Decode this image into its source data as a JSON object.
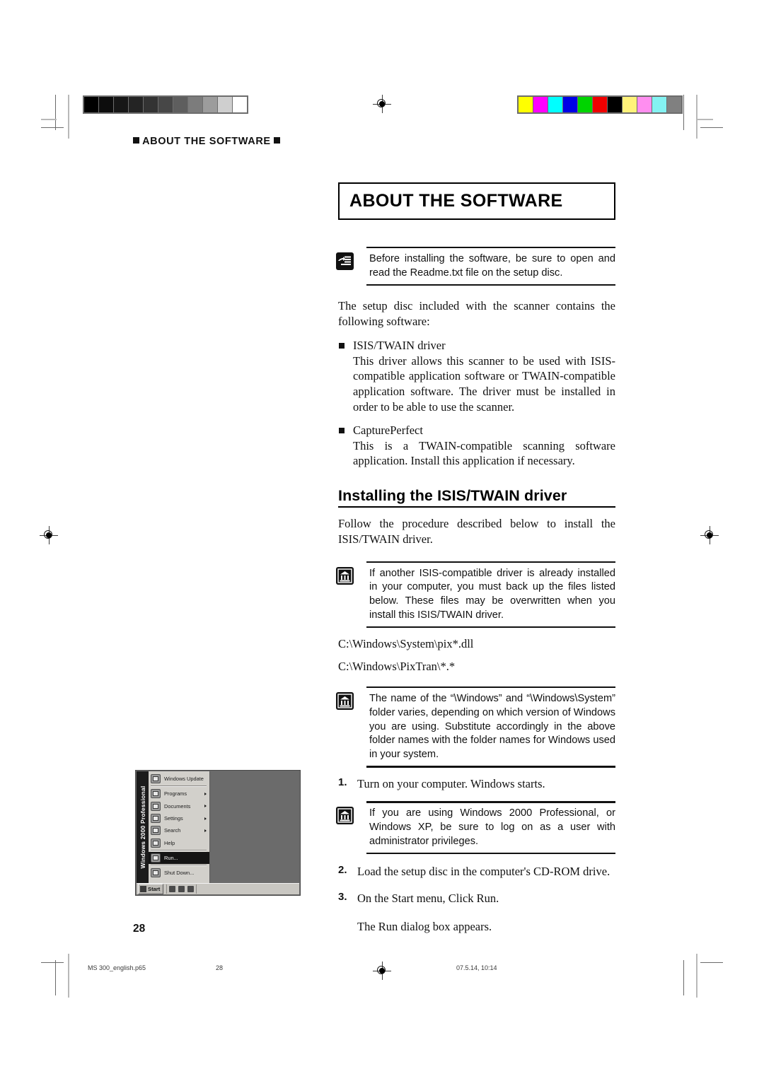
{
  "document": {
    "running_head": "ABOUT THE SOFTWARE",
    "page_number": "28"
  },
  "chapter": {
    "title": "ABOUT THE SOFTWARE"
  },
  "notes": [
    {
      "icon": "note-hand-icon",
      "text": "Before installing the software, be sure to open and read the Readme.txt file on the setup disc."
    },
    {
      "icon": "important-memo-icon",
      "text": "If another ISIS-compatible driver is already installed in your computer, you must back up the files listed below. These files may be overwritten when you install this ISIS/TWAIN driver."
    },
    {
      "icon": "important-memo-icon",
      "text": "The name of the “\\Windows” and “\\Windows\\System” folder varies, depending on which version of Windows you are using. Substitute accordingly in the above folder names with the folder names for Windows used in your system."
    },
    {
      "icon": "important-memo-icon",
      "text": "If you are using Windows 2000 Professional, or Windows XP, be sure to log on as a user with administrator privileges."
    }
  ],
  "intro": {
    "paragraph": "The setup disc included with the scanner contains the following software:"
  },
  "software_list": [
    {
      "name": "ISIS/TWAIN driver",
      "description": "This driver allows this scanner to be used with ISIS-compatible application software or TWAIN-compatible application software. The driver must be installed in order to be able to use the scanner."
    },
    {
      "name": "CapturePerfect",
      "description": "This is a TWAIN-compatible scanning software application. Install this application if necessary."
    }
  ],
  "section": {
    "heading": "Installing the ISIS/TWAIN driver",
    "lead": "Follow the procedure described below to install the ISIS/TWAIN driver.",
    "paths": [
      "C:\\Windows\\System\\pix*.dll",
      "C:\\Windows\\PixTran\\*.*"
    ],
    "steps": [
      {
        "number": "1.",
        "text": "Turn on your computer. Windows starts."
      },
      {
        "number": "2.",
        "text": "Load the setup disc in the computer's CD-ROM drive."
      },
      {
        "number": "3.",
        "text": "On the Start menu, Click Run."
      }
    ],
    "result": "The Run dialog box appears."
  },
  "screenshot": {
    "brand_label": "Windows 2000 Professional",
    "menu_items": [
      {
        "label": "Windows Update",
        "icon": "windows-update-icon",
        "submenu": false,
        "selected": false
      },
      {
        "label": "Programs",
        "icon": "programs-folder-icon",
        "submenu": true,
        "selected": false
      },
      {
        "label": "Documents",
        "icon": "documents-folder-icon",
        "submenu": true,
        "selected": false
      },
      {
        "label": "Settings",
        "icon": "settings-gear-icon",
        "submenu": true,
        "selected": false
      },
      {
        "label": "Search",
        "icon": "search-magnifier-icon",
        "submenu": true,
        "selected": false
      },
      {
        "label": "Help",
        "icon": "help-book-icon",
        "submenu": false,
        "selected": false
      },
      {
        "label": "Run...",
        "icon": "run-icon",
        "submenu": false,
        "selected": true
      },
      {
        "label": "Shut Down...",
        "icon": "shutdown-icon",
        "submenu": false,
        "selected": false
      }
    ],
    "taskbar": {
      "start_label": "Start"
    }
  },
  "calibration": {
    "grayscale_swatches": [
      "#000000",
      "#0d0d0d",
      "#171717",
      "#242424",
      "#333333",
      "#474747",
      "#5e5e5e",
      "#7c7c7c",
      "#9c9c9c",
      "#cfcfcf",
      "#ffffff"
    ],
    "color_swatches": [
      "#ffff00",
      "#ff00ff",
      "#00ffff",
      "#0000e6",
      "#00d400",
      "#ee0000",
      "#000000",
      "#fff27a",
      "#ff8ef0",
      "#84f2f2",
      "#808080"
    ]
  },
  "footer": {
    "filename": "MS 300_english.p65",
    "page": "28",
    "timestamp": "07.5.14, 10:14"
  }
}
